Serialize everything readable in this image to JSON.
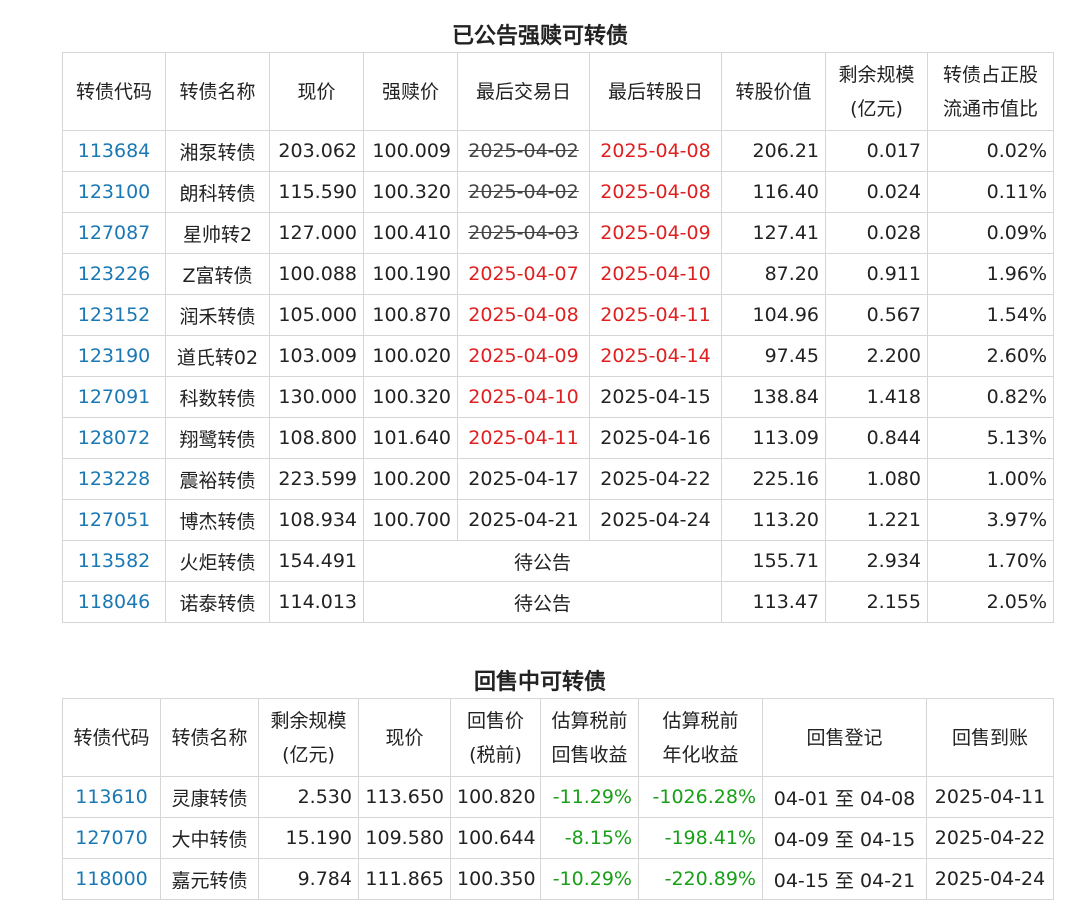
{
  "table1": {
    "title": "已公告强赎可转债",
    "headers": [
      "转债代码",
      "转债名称",
      "现价",
      "强赎价",
      "最后交易日",
      "最后转股日",
      "转股价值",
      "剩余规模\n(亿元)",
      "转债占正股\n流通市值比"
    ],
    "rows": [
      {
        "code": "113684",
        "name": "湘泵转债",
        "price": "203.062",
        "redeem": "100.009",
        "last_trade": "2025-04-02",
        "last_trade_style": "strike",
        "last_conv": "2025-04-08",
        "last_conv_style": "red",
        "conv_value": "206.21",
        "remain": "0.017",
        "ratio": "0.02%"
      },
      {
        "code": "123100",
        "name": "朗科转债",
        "price": "115.590",
        "redeem": "100.320",
        "last_trade": "2025-04-02",
        "last_trade_style": "strike",
        "last_conv": "2025-04-08",
        "last_conv_style": "red",
        "conv_value": "116.40",
        "remain": "0.024",
        "ratio": "0.11%"
      },
      {
        "code": "127087",
        "name": "星帅转2",
        "price": "127.000",
        "redeem": "100.410",
        "last_trade": "2025-04-03",
        "last_trade_style": "strike",
        "last_conv": "2025-04-09",
        "last_conv_style": "red",
        "conv_value": "127.41",
        "remain": "0.028",
        "ratio": "0.09%"
      },
      {
        "code": "123226",
        "name": "Z富转债",
        "price": "100.088",
        "redeem": "100.190",
        "last_trade": "2025-04-07",
        "last_trade_style": "red",
        "last_conv": "2025-04-10",
        "last_conv_style": "red",
        "conv_value": "87.20",
        "remain": "0.911",
        "ratio": "1.96%"
      },
      {
        "code": "123152",
        "name": "润禾转债",
        "price": "105.000",
        "redeem": "100.870",
        "last_trade": "2025-04-08",
        "last_trade_style": "red",
        "last_conv": "2025-04-11",
        "last_conv_style": "red",
        "conv_value": "104.96",
        "remain": "0.567",
        "ratio": "1.54%"
      },
      {
        "code": "123190",
        "name": "道氏转02",
        "price": "103.009",
        "redeem": "100.020",
        "last_trade": "2025-04-09",
        "last_trade_style": "red",
        "last_conv": "2025-04-14",
        "last_conv_style": "red",
        "conv_value": "97.45",
        "remain": "2.200",
        "ratio": "2.60%"
      },
      {
        "code": "127091",
        "name": "科数转债",
        "price": "130.000",
        "redeem": "100.320",
        "last_trade": "2025-04-10",
        "last_trade_style": "red",
        "last_conv": "2025-04-15",
        "last_conv_style": "normal",
        "conv_value": "138.84",
        "remain": "1.418",
        "ratio": "0.82%"
      },
      {
        "code": "128072",
        "name": "翔鹭转债",
        "price": "108.800",
        "redeem": "101.640",
        "last_trade": "2025-04-11",
        "last_trade_style": "red",
        "last_conv": "2025-04-16",
        "last_conv_style": "normal",
        "conv_value": "113.09",
        "remain": "0.844",
        "ratio": "5.13%"
      },
      {
        "code": "123228",
        "name": "震裕转债",
        "price": "223.599",
        "redeem": "100.200",
        "last_trade": "2025-04-17",
        "last_trade_style": "normal",
        "last_conv": "2025-04-22",
        "last_conv_style": "normal",
        "conv_value": "225.16",
        "remain": "1.080",
        "ratio": "1.00%"
      },
      {
        "code": "127051",
        "name": "博杰转债",
        "price": "108.934",
        "redeem": "100.700",
        "last_trade": "2025-04-21",
        "last_trade_style": "normal",
        "last_conv": "2025-04-24",
        "last_conv_style": "normal",
        "conv_value": "113.20",
        "remain": "1.221",
        "ratio": "3.97%"
      },
      {
        "code": "113582",
        "name": "火炬转债",
        "price": "154.491",
        "pending": "待公告",
        "conv_value": "155.71",
        "remain": "2.934",
        "ratio": "1.70%"
      },
      {
        "code": "118046",
        "name": "诺泰转债",
        "price": "114.013",
        "pending": "待公告",
        "conv_value": "113.47",
        "remain": "2.155",
        "ratio": "2.05%"
      }
    ]
  },
  "table2": {
    "title": "回售中可转债",
    "headers": [
      "转债代码",
      "转债名称",
      "剩余规模\n(亿元)",
      "现价",
      "回售价\n(税前)",
      "估算税前\n回售收益",
      "估算税前\n年化收益",
      "回售登记",
      "回售到账"
    ],
    "rows": [
      {
        "code": "113610",
        "name": "灵康转债",
        "remain": "2.530",
        "price": "113.650",
        "put_price": "100.820",
        "yield": "-11.29%",
        "annual": "-1026.28%",
        "register": "04-01 至 04-08",
        "arrive": "2025-04-11"
      },
      {
        "code": "127070",
        "name": "大中转债",
        "remain": "15.190",
        "price": "109.580",
        "put_price": "100.644",
        "yield": "-8.15%",
        "annual": "-198.41%",
        "register": "04-09 至 04-15",
        "arrive": "2025-04-22"
      },
      {
        "code": "118000",
        "name": "嘉元转债",
        "remain": "9.784",
        "price": "111.865",
        "put_price": "100.350",
        "yield": "-10.29%",
        "annual": "-220.89%",
        "register": "04-15 至 04-21",
        "arrive": "2025-04-24"
      }
    ]
  },
  "colors": {
    "code": "#1a78b4",
    "red": "#e02020",
    "green": "#18a018",
    "border": "#d6d6d6"
  }
}
